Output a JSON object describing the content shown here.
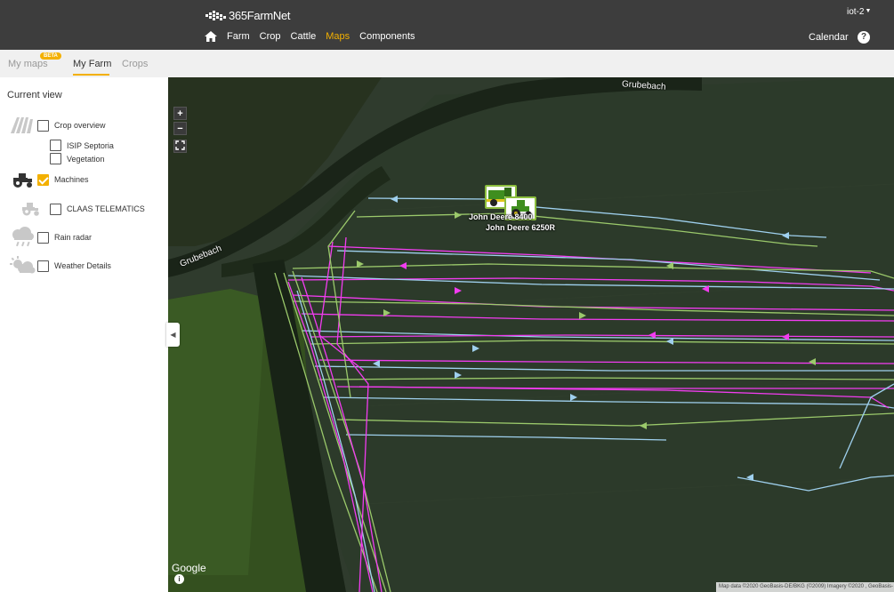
{
  "app": {
    "brand": "365FarmNet",
    "user": "iot-2"
  },
  "nav": {
    "items": [
      "Farm",
      "Crop",
      "Cattle",
      "Maps",
      "Components"
    ],
    "active": "Maps",
    "calendar": "Calendar",
    "help": "?"
  },
  "tabs": {
    "items": [
      "My maps",
      "My Farm",
      "Crops"
    ],
    "active": "My Farm",
    "beta_badge": "BETA"
  },
  "panel": {
    "title": "Current view",
    "layers": [
      {
        "label": "Crop overview",
        "checked": false,
        "icon": "crop-overview-icon"
      },
      {
        "label": "ISIP Septoria",
        "checked": false,
        "icon": ""
      },
      {
        "label": "Vegetation",
        "checked": false,
        "icon": ""
      },
      {
        "label": "Machines",
        "checked": true,
        "icon": "tractor-icon"
      },
      {
        "label": "CLAAS TELEMATICS",
        "checked": false,
        "icon": "tractor-outline-icon"
      },
      {
        "label": "Rain radar",
        "checked": false,
        "icon": "rain-cloud-icon"
      },
      {
        "label": "Weather Details",
        "checked": false,
        "icon": "sun-cloud-icon"
      }
    ]
  },
  "map": {
    "zoom_in": "+",
    "zoom_out": "−",
    "street_labels": [
      "Grubebach",
      "Grubebach"
    ],
    "machines": [
      "John Deere 8400",
      "John Deere 6250R"
    ],
    "google_logo": "Google",
    "attribution": "Map data ©2020 GeoBasis-DE/BKG (©2009) Imagery ©2020 , GeoBasis-",
    "colors": {
      "track_blue": "#9fd0ee",
      "track_green": "#9bc96b",
      "track_magenta": "#f23cf0",
      "accent": "#f3b000"
    }
  }
}
